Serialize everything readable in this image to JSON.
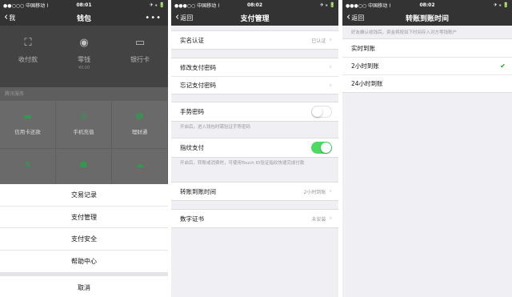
{
  "screen1": {
    "status": {
      "carrier": "●●○○○ 中国移动 ⌇",
      "time": "08:01",
      "right": "✈ ⁎ 🔋"
    },
    "nav": {
      "back": "我",
      "title": "钱包",
      "more": "•••"
    },
    "top": [
      {
        "label": "收付款",
        "icon": "scan-pay-icon",
        "sub": ""
      },
      {
        "label": "零钱",
        "icon": "coin-icon",
        "sub": "¥0.00"
      },
      {
        "label": "银行卡",
        "icon": "bank-card-icon",
        "sub": ""
      }
    ],
    "section_label": "腾讯服务",
    "services": [
      {
        "label": "信用卡还款",
        "icon": "credit-card-icon"
      },
      {
        "label": "手机充值",
        "icon": "phone-recharge-icon"
      },
      {
        "label": "理财通",
        "icon": "wealth-icon"
      },
      {
        "label": "",
        "icon": "lightning-icon"
      },
      {
        "label": "",
        "icon": "qq-icon"
      },
      {
        "label": "",
        "icon": "cloud-icon"
      }
    ],
    "sheet": {
      "items": [
        "交易记录",
        "支付管理",
        "支付安全",
        "帮助中心"
      ],
      "cancel": "取消"
    }
  },
  "screen2": {
    "status": {
      "carrier": "●●●○○ 中国移动 ⌇",
      "time": "08:02",
      "right": "✈ ⁎ 🔋"
    },
    "nav": {
      "back": "返回",
      "title": "支付管理"
    },
    "realname": {
      "label": "实名认证",
      "value": "已认证"
    },
    "modify_pwd": "修改支付密码",
    "forgot_pwd": "忘记支付密码",
    "gesture": {
      "label": "手势密码",
      "on": false,
      "note": "开启后，进入钱包时需验证手势密码"
    },
    "fingerprint": {
      "label": "指纹支付",
      "on": true,
      "note": "开启后，转账或消费时，可使用Touch ID验证指纹快速完成付款"
    },
    "transfer_time": {
      "label": "转账到账时间",
      "value": "2小时到账"
    },
    "certificate": {
      "label": "数字证书",
      "value": "未安装"
    }
  },
  "screen3": {
    "status": {
      "carrier": "●●●○○ 中国移动 ⌇",
      "time": "08:02",
      "right": "✈ ⁎ 🔋"
    },
    "nav": {
      "back": "返回",
      "title": "转账到账时间"
    },
    "note": "好友确认收钱后，资金将按如下时间存入对方零钱账户",
    "options": [
      {
        "label": "实时到账",
        "selected": false
      },
      {
        "label": "2小时到账",
        "selected": true
      },
      {
        "label": "24小时到账",
        "selected": false
      }
    ],
    "check_mark": "✔"
  },
  "colors": {
    "green": "#4cd964",
    "nav": "#333333",
    "check": "#1aad19"
  }
}
